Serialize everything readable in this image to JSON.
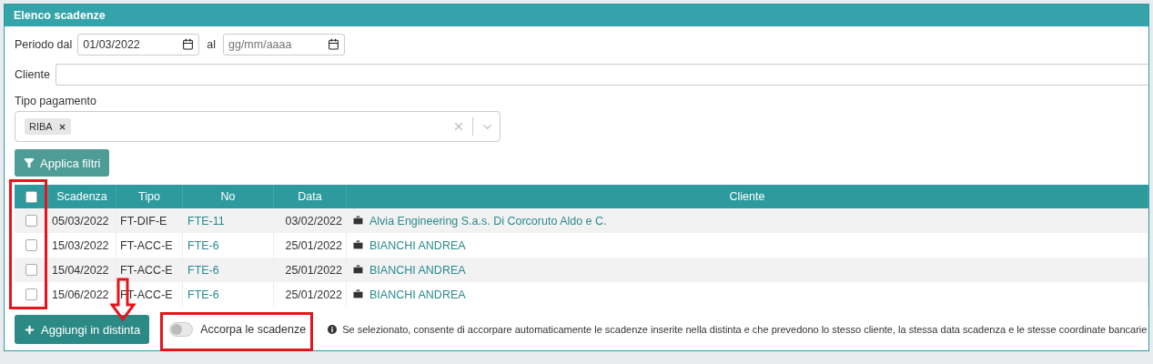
{
  "panel": {
    "title": "Elenco scadenze"
  },
  "filters": {
    "period_label": "Periodo dal",
    "date_from": {
      "value": "01/03/2022"
    },
    "to_label": "al",
    "date_to": {
      "placeholder": "gg/mm/aaaa"
    },
    "client_label": "Cliente",
    "payment_label": "Tipo pagamento",
    "payment_tags": [
      {
        "label": "RIBA"
      }
    ],
    "apply_button": "Applica filtri"
  },
  "table": {
    "select_all": {
      "checked": false
    },
    "columns": [
      "Scadenza",
      "Tipo",
      "No",
      "Data",
      "Cliente"
    ],
    "rows": [
      {
        "checked": false,
        "scadenza": "05/03/2022",
        "tipo": "FT-DIF-E",
        "no": "FTE-11",
        "data": "03/02/2022",
        "cliente": "Alvia Engineering S.a.s. Di Corcoruto Aldo e C."
      },
      {
        "checked": false,
        "scadenza": "15/03/2022",
        "tipo": "FT-ACC-E",
        "no": "FTE-6",
        "data": "25/01/2022",
        "cliente": "BIANCHI ANDREA"
      },
      {
        "checked": false,
        "scadenza": "15/04/2022",
        "tipo": "FT-ACC-E",
        "no": "FTE-6",
        "data": "25/01/2022",
        "cliente": "BIANCHI ANDREA"
      },
      {
        "checked": false,
        "scadenza": "15/06/2022",
        "tipo": "FT-ACC-E",
        "no": "FTE-6",
        "data": "25/01/2022",
        "cliente": "BIANCHI ANDREA"
      }
    ]
  },
  "footer": {
    "add_button": "Aggiungi in distinta",
    "merge_toggle": {
      "label": "Accorpa le scadenze",
      "on": false
    },
    "info": "Se selezionato, consente di accorpare automaticamente le scadenze inserite nella distinta e che prevedono lo stesso cliente, la stessa data scadenza e le stesse coordinate bancarie"
  }
}
